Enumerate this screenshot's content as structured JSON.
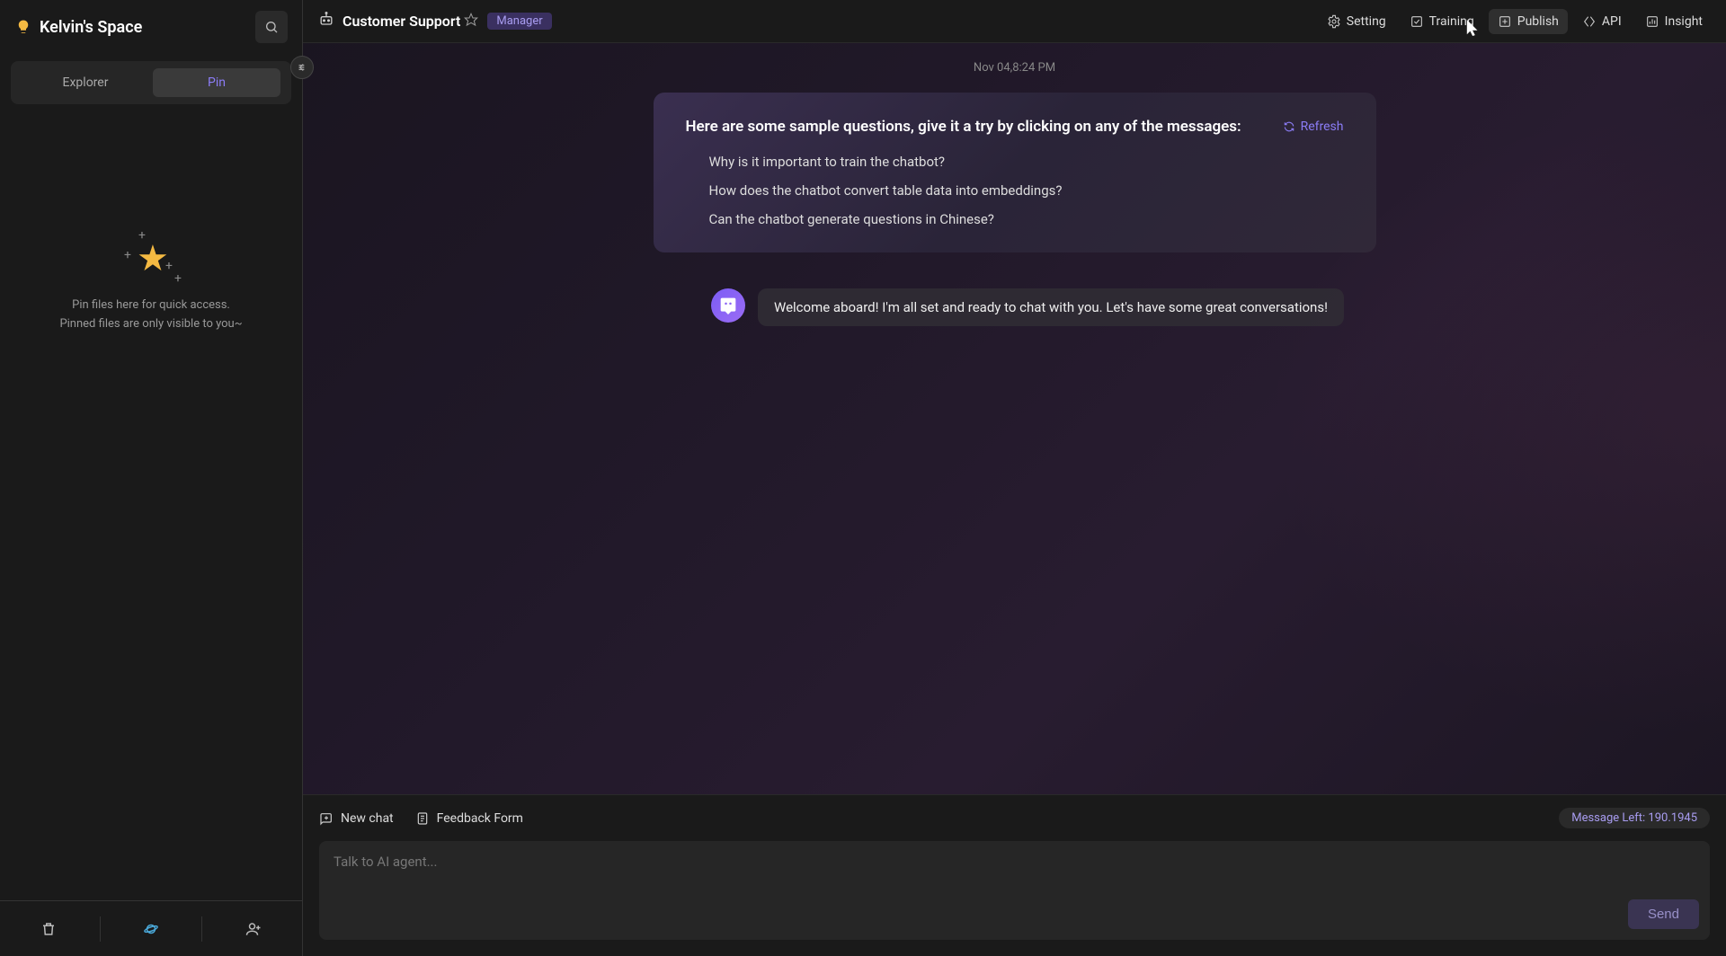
{
  "sidebar": {
    "title": "Kelvin's Space",
    "tabs": {
      "explorer": "Explorer",
      "pin": "Pin"
    },
    "empty": {
      "line1": "Pin files here for quick access.",
      "line2": "Pinned files are only visible to you~"
    }
  },
  "header": {
    "agent_name": "Customer Support",
    "badge": "Manager",
    "nav": {
      "setting": "Setting",
      "training": "Training",
      "publish": "Publish",
      "api": "API",
      "insight": "Insight"
    }
  },
  "chat": {
    "timestamp": "Nov 04,8:24 PM",
    "sample_title": "Here are some sample questions, give it a try by clicking on any of the messages:",
    "refresh": "Refresh",
    "questions": [
      "Why is it important to train the chatbot?",
      "How does the chatbot convert table data into embeddings?",
      "Can the chatbot generate questions in Chinese?"
    ],
    "welcome": "Welcome aboard! I'm all set and ready to chat with you. Let's have some great conversations!"
  },
  "composer": {
    "new_chat": "New chat",
    "feedback": "Feedback Form",
    "messages_left": "Message Left: 190.1945",
    "placeholder": "Talk to AI agent...",
    "send": "Send"
  }
}
